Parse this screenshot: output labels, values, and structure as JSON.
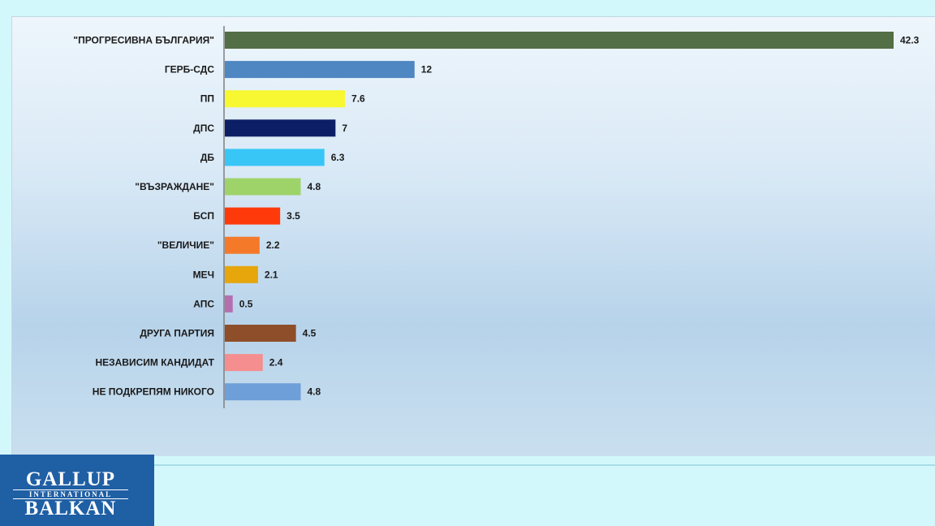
{
  "chart_data": {
    "type": "bar",
    "orientation": "horizontal",
    "categories": [
      "\"ПРОГРЕСИВНА БЪЛГАРИЯ\"",
      "ГЕРБ-СДС",
      "ПП",
      "ДПС",
      "ДБ",
      "\"ВЪЗРАЖДАНЕ\"",
      "БСП",
      "\"ВЕЛИЧИЕ\"",
      "МЕЧ",
      "АПС",
      "ДРУГА ПАРТИЯ",
      "НЕЗАВИСИМ КАНДИДАТ",
      "НЕ ПОДКРЕПЯМ НИКОГО"
    ],
    "values": [
      42.3,
      12,
      7.6,
      7,
      6.3,
      4.8,
      3.5,
      2.2,
      2.1,
      0.5,
      4.5,
      2.4,
      4.8
    ],
    "value_labels": [
      "42.3",
      "12",
      "7.6",
      "7",
      "6.3",
      "4.8",
      "3.5",
      "2.2",
      "2.1",
      "0.5",
      "4.5",
      "2.4",
      "4.8"
    ],
    "colors": [
      "#536f45",
      "#4f87c2",
      "#f7f732",
      "#0c1f66",
      "#38c6f7",
      "#9ed36a",
      "#ff3a0a",
      "#f47a2a",
      "#e6a60c",
      "#b56fb0",
      "#8e4e2a",
      "#f58e8e",
      "#6f9fd8"
    ],
    "xlim": [
      0,
      42.3
    ],
    "grid": false,
    "legend": "none"
  },
  "logo": {
    "top": "GALLUP",
    "middle": "INTERNATIONAL",
    "bottom": "BALKAN"
  }
}
